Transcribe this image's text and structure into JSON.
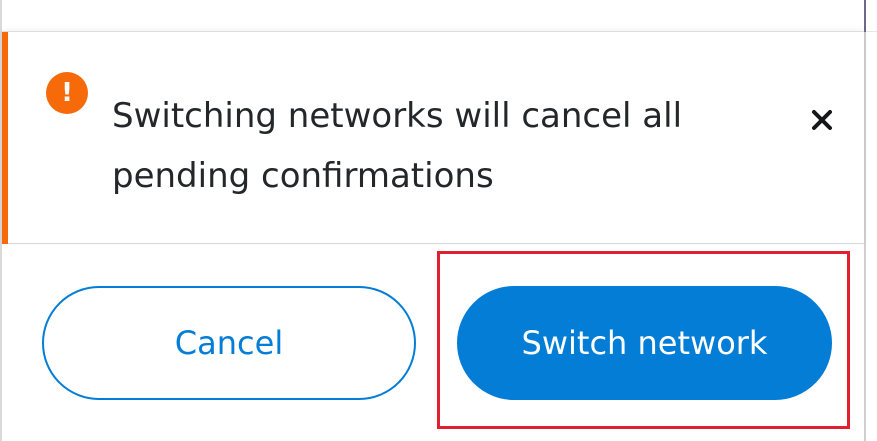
{
  "alert": {
    "icon": "exclamation-circle-icon",
    "icon_glyph": "!",
    "accent_color": "#f66a0a",
    "message": "Switching networks will cancel all pending confirmations",
    "close_icon": "close-icon"
  },
  "actions": {
    "cancel_label": "Cancel",
    "switch_label": "Switch network",
    "primary_color": "#037dd6"
  },
  "highlight": {
    "color": "#e0202e",
    "target": "switch-network-button"
  }
}
